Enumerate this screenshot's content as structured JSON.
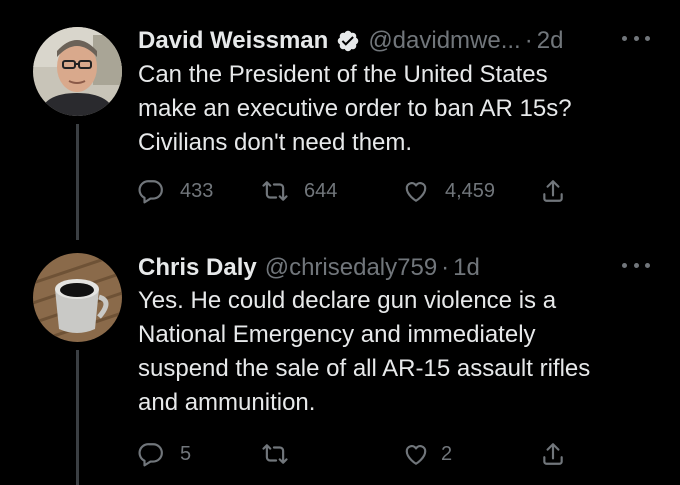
{
  "tweets": [
    {
      "author": "David Weissman",
      "verified": true,
      "handle": "@davidmwe...",
      "separator": "·",
      "time": "2d",
      "text": "Can the President of the United States\nmake an executive order to ban AR 15s?\nCivilians don't need them.",
      "replies": "433",
      "retweets": "644",
      "likes": "4,459"
    },
    {
      "author": "Chris Daly",
      "verified": false,
      "handle": "@chrisedaly759",
      "separator": "·",
      "time": "1d",
      "text": "Yes.  He could declare gun violence is a\nNational Emergency and immediately\nsuspend the sale of all AR-15 assault rifles\nand ammunition.",
      "replies": "5",
      "retweets": "",
      "likes": "2"
    }
  ],
  "colors": {
    "background": "#000000",
    "text": "#e7e9ea",
    "muted": "#71767b",
    "verified": "#1d9bf0",
    "thread_line": "#3b3f43"
  },
  "icons": [
    "reply-icon",
    "retweet-icon",
    "like-icon",
    "share-icon",
    "verified-badge-icon",
    "more-options-icon"
  ]
}
